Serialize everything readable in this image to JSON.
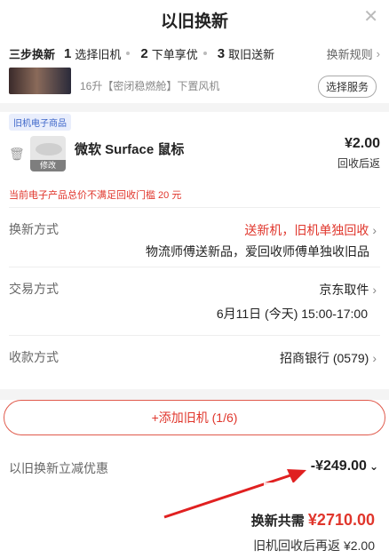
{
  "header": {
    "title": "以旧换新",
    "close_icon": "close-icon"
  },
  "steps": {
    "lead": "三步换新",
    "items": [
      {
        "num": "1",
        "label": "选择旧机"
      },
      {
        "num": "2",
        "label": "下单享优"
      },
      {
        "num": "3",
        "label": "取旧送新"
      }
    ],
    "rules_label": "换新规则"
  },
  "service": {
    "desc": "16升【密闭稳燃舱】下置风机",
    "button": "选择服务"
  },
  "old_item": {
    "tag": "旧机电子商品",
    "name": "微软 Surface 鼠标",
    "edit_label": "修改",
    "price": "¥2.00",
    "note": "回收后返",
    "warning": "当前电子产品总价不满足回收门槛 20 元"
  },
  "rows": {
    "renew_method_label": "换新方式",
    "renew_method_value": "送新机，旧机单独回收",
    "renew_method_sub": "物流师傅送新品，爱回收师傅单独收旧品",
    "trade_label": "交易方式",
    "trade_value": "京东取件",
    "trade_time": "6月11日 (今天) 15:00-17:00",
    "payment_label": "收款方式",
    "payment_value": "招商银行 (0579)"
  },
  "add_button": "+添加旧机 (1/6)",
  "discount": {
    "label": "以旧换新立减优惠",
    "value": "-¥249.00"
  },
  "summary": {
    "total_label": "换新共需",
    "total_value": "¥2710.00",
    "refund_line": "旧机回收后再返 ¥2.00"
  },
  "colors": {
    "accent": "#e0362c",
    "tag_blue": "#3d66c9"
  }
}
